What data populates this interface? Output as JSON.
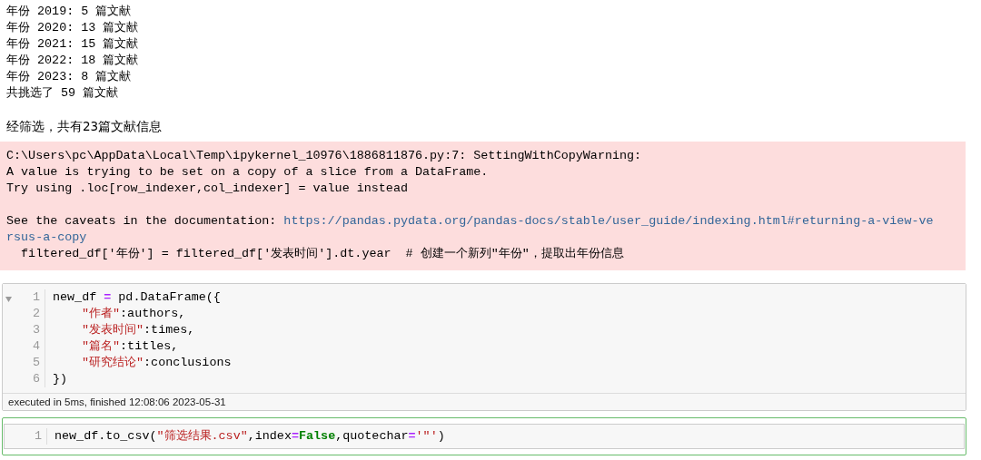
{
  "output_lines": [
    "年份 2019: 5 篇文献",
    "年份 2020: 13 篇文献",
    "年份 2021: 15 篇文献",
    "年份 2022: 18 篇文献",
    "年份 2023: 8 篇文献",
    "共挑选了 59 篇文献"
  ],
  "summary": "经筛选，共有23篇文献信息",
  "warning": {
    "lines": [
      "C:\\Users\\pc\\AppData\\Local\\Temp\\ipykernel_10976\\1886811876.py:7: SettingWithCopyWarning:",
      "A value is trying to be set on a copy of a slice from a DataFrame.",
      "Try using .loc[row_indexer,col_indexer] = value instead"
    ],
    "caveat_prefix": "See the caveats in the documentation: ",
    "link_lines": [
      "https://pandas.pydata.org/pandas-docs/stable/user_guide/indexing.html#returning-a-view-ve",
      "rsus-a-copy"
    ],
    "source_line": "  filtered_df['年份'] = filtered_df['发表时间'].dt.year  # 创建一个新列\"年份\"，提取出年份信息"
  },
  "cells": [
    {
      "selected": false,
      "lines": [
        {
          "number": "1",
          "tokens": [
            {
              "kind": "plain",
              "text": "new_df "
            },
            {
              "kind": "operator",
              "text": "="
            },
            {
              "kind": "plain",
              "text": " pd.DataFrame({"
            }
          ]
        },
        {
          "number": "2",
          "indented": true,
          "tokens": [
            {
              "kind": "string",
              "text": "\"作者\""
            },
            {
              "kind": "plain",
              "text": ":authors,"
            }
          ]
        },
        {
          "number": "3",
          "indented": true,
          "tokens": [
            {
              "kind": "string",
              "text": "\"发表时间\""
            },
            {
              "kind": "plain",
              "text": ":times,"
            }
          ]
        },
        {
          "number": "4",
          "indented": true,
          "tokens": [
            {
              "kind": "string",
              "text": "\"篇名\""
            },
            {
              "kind": "plain",
              "text": ":titles,"
            }
          ]
        },
        {
          "number": "5",
          "indented": true,
          "tokens": [
            {
              "kind": "string",
              "text": "\"研究结论\""
            },
            {
              "kind": "plain",
              "text": ":conclusions"
            }
          ]
        },
        {
          "number": "6",
          "tokens": [
            {
              "kind": "plain",
              "text": "})"
            }
          ]
        }
      ],
      "footer": "executed in 5ms, finished 12:08:06 2023-05-31"
    },
    {
      "selected": true,
      "lines": [
        {
          "number": "1",
          "tokens": [
            {
              "kind": "plain",
              "text": "new_df.to_csv("
            },
            {
              "kind": "string",
              "text": "\"筛选结果.csv\""
            },
            {
              "kind": "plain",
              "text": ",index"
            },
            {
              "kind": "operator",
              "text": "="
            },
            {
              "kind": "keyword",
              "text": "False"
            },
            {
              "kind": "plain",
              "text": ",quotechar"
            },
            {
              "kind": "operator",
              "text": "="
            },
            {
              "kind": "string",
              "text": "'\"'"
            },
            {
              "kind": "plain",
              "text": ")"
            }
          ]
        }
      ]
    }
  ]
}
